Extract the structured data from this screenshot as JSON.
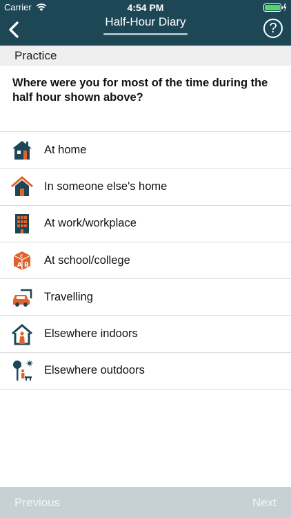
{
  "status_bar": {
    "carrier": "Carrier",
    "time": "4:54 PM"
  },
  "nav": {
    "title": "Half-Hour Diary",
    "help_symbol": "?",
    "progress": 1.0
  },
  "section": {
    "label": "Practice"
  },
  "question": {
    "text": "Where were you for most of the time during the half hour shown above?"
  },
  "options": [
    {
      "label": "At home",
      "icon": "house-icon"
    },
    {
      "label": "In someone else's home",
      "icon": "house-orange-icon"
    },
    {
      "label": "At work/workplace",
      "icon": "office-building-icon"
    },
    {
      "label": "At school/college",
      "icon": "abc-block-icon"
    },
    {
      "label": "Travelling",
      "icon": "car-icon"
    },
    {
      "label": "Elsewhere indoors",
      "icon": "indoors-icon"
    },
    {
      "label": "Elsewhere outdoors",
      "icon": "outdoors-icon"
    }
  ],
  "footer": {
    "previous_label": "Previous",
    "next_label": "Next"
  },
  "colors": {
    "header": "#1e4756",
    "accent_orange": "#e3622c",
    "footer": "#c7d0d5"
  }
}
